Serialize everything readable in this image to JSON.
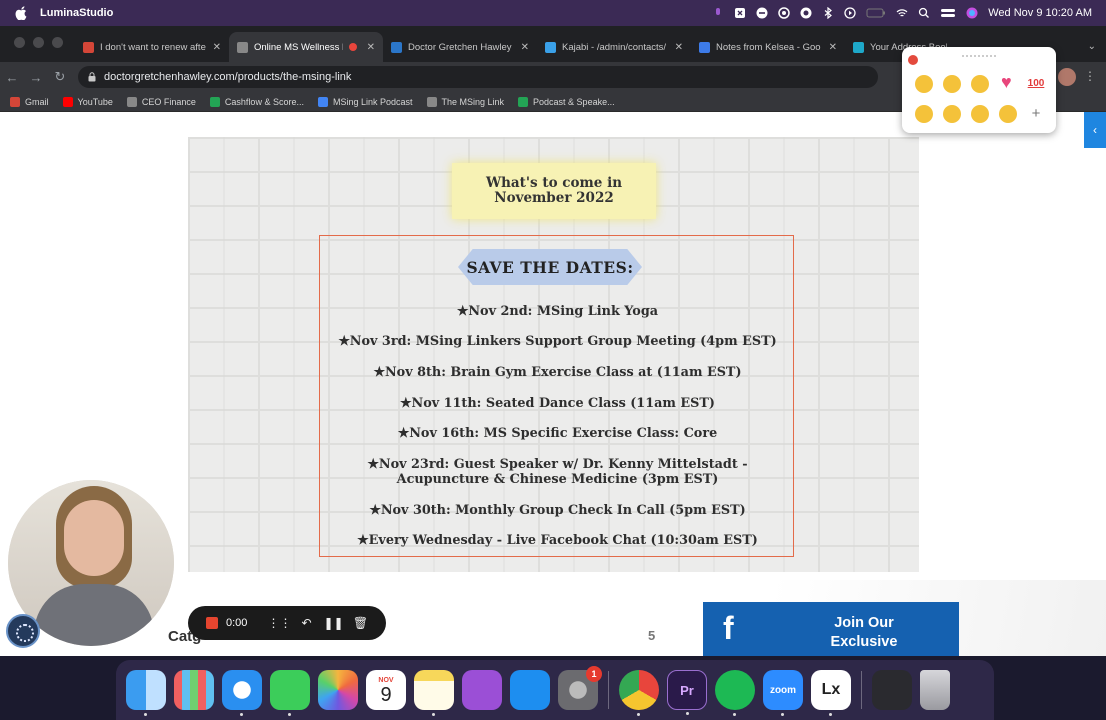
{
  "menubar": {
    "app_name": "LuminaStudio",
    "datetime": "Wed Nov 9  10:20 AM"
  },
  "browser": {
    "tabs": [
      {
        "title": "I don't want to renew afte",
        "favicon_color": "#d44638"
      },
      {
        "title": "Online MS Wellness F",
        "favicon_color": "#888888"
      },
      {
        "title": "Doctor Gretchen Hawley",
        "favicon_color": "#2b76c9"
      },
      {
        "title": "Kajabi - /admin/contacts/",
        "favicon_color": "#3aa0e8"
      },
      {
        "title": "Notes from Kelsea - Goo",
        "favicon_color": "#3d7be8"
      },
      {
        "title": "Your Address Book | Privacy",
        "favicon_color": "#1ea8c9"
      }
    ],
    "url": "doctorgretchenhawley.com/products/the-msing-link",
    "bookmarks": [
      {
        "label": "Gmail",
        "color": "#d44638"
      },
      {
        "label": "YouTube",
        "color": "#ff0000"
      },
      {
        "label": "CEO Finance",
        "color": "#888888"
      },
      {
        "label": "Cashflow & Score...",
        "color": "#23a455"
      },
      {
        "label": "MSing Link Podcast",
        "color": "#4285f4"
      },
      {
        "label": "The MSing Link",
        "color": "#888888"
      },
      {
        "label": "Podcast & Speake...",
        "color": "#23a455"
      }
    ]
  },
  "flyer": {
    "note": "What's to come in\nNovember 2022",
    "banner": "SAVE THE DATES:",
    "events": [
      "★Nov 2nd: MSing Link Yoga",
      "★Nov 3rd: MSing Linkers Support Group Meeting (4pm EST)",
      "★Nov 8th: Brain Gym Exercise Class at (11am EST)",
      "★Nov 11th: Seated Dance Class (11am EST)",
      "★Nov 16th: MS Specific Exercise Class: Core",
      "★Nov 23rd: Guest Speaker w/ Dr. Kenny Mittelstadt -\nAcupuncture & Chinese Medicine (3pm EST)",
      "★Nov 30th: Monthly Group Check In Call (5pm EST)",
      "★Every Wednesday - Live Facebook Chat (10:30am EST)"
    ]
  },
  "page": {
    "category_label": "Catg",
    "count": "5",
    "facebook_button": "Join Our\nExclusive"
  },
  "recorder": {
    "time": "0:00"
  },
  "dock": {
    "calendar_month": "NOV",
    "calendar_day": "9",
    "settings_badge": "1",
    "apps": [
      {
        "name": "Finder",
        "color": "#3b9cf0"
      },
      {
        "name": "Launchpad",
        "color": "#e9e9ee"
      },
      {
        "name": "Safari",
        "color": "#2a8ff0"
      },
      {
        "name": "Messages",
        "color": "#3ccd5a"
      },
      {
        "name": "Photos",
        "color": "#f3f3f3"
      },
      {
        "name": "Calendar",
        "color": "#ffffff"
      },
      {
        "name": "Notes",
        "color": "#f7d75a"
      },
      {
        "name": "Podcasts",
        "color": "#9b4fd6"
      },
      {
        "name": "App Store",
        "color": "#1d8ef0"
      },
      {
        "name": "System Preferences",
        "color": "#8b8b8f"
      },
      {
        "name": "Chrome",
        "color": "#ffffff"
      },
      {
        "name": "Premiere Pro",
        "color": "#2a1a4a"
      },
      {
        "name": "Spotify",
        "color": "#1db954"
      },
      {
        "name": "Zoom",
        "color": "#2d8cff"
      },
      {
        "name": "Lx",
        "color": "#ffffff"
      }
    ],
    "premiere_label": "Pr",
    "zoom_label": "zoom",
    "lx_label": "Lx"
  }
}
